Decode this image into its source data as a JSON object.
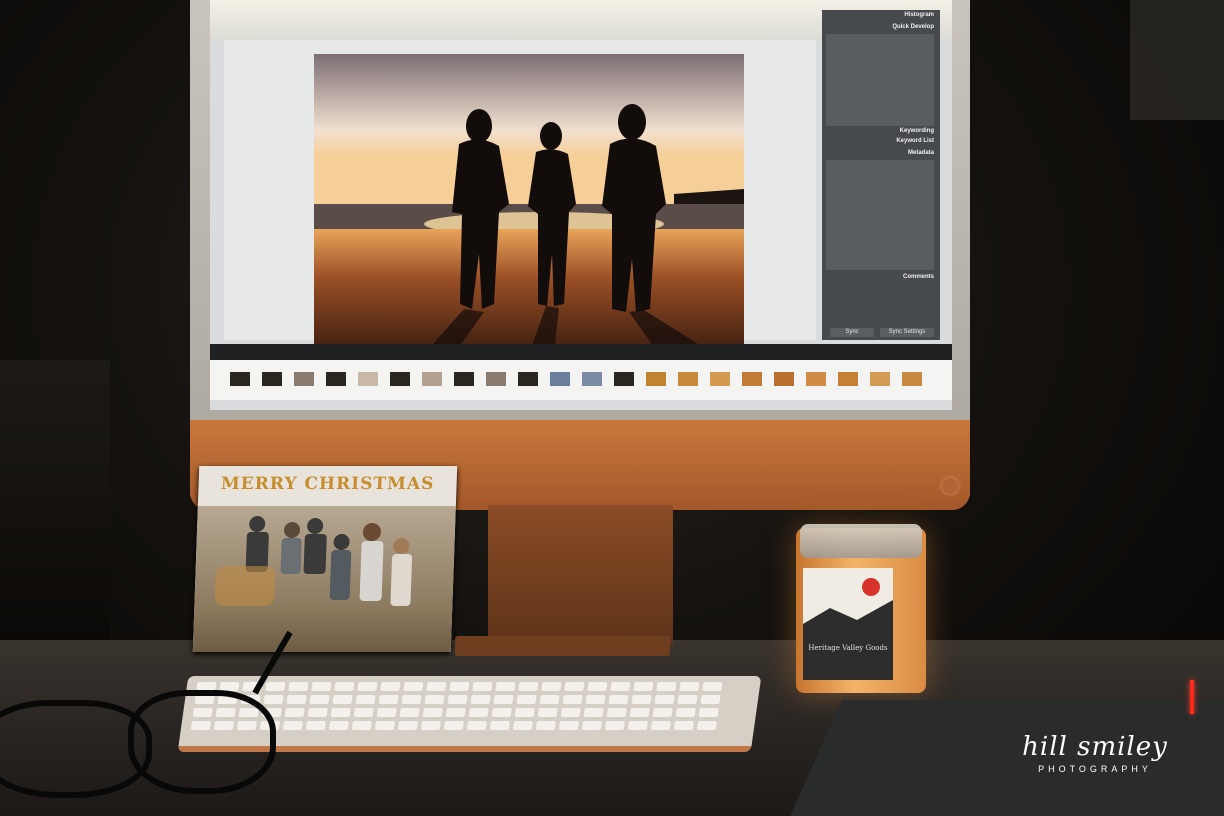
{
  "screen": {
    "panel_titles": [
      "Histogram",
      "Quick Develop",
      "Keywording",
      "Keyword List",
      "Metadata",
      "Comments"
    ],
    "panel_buttons": [
      "Sync",
      "Sync Settings"
    ]
  },
  "card": {
    "title": "MERRY CHRISTMAS"
  },
  "candle": {
    "label": "Heritage Valley Goods"
  },
  "watermark": {
    "main": "hill smiley",
    "sub": "PHOTOGRAPHY"
  }
}
